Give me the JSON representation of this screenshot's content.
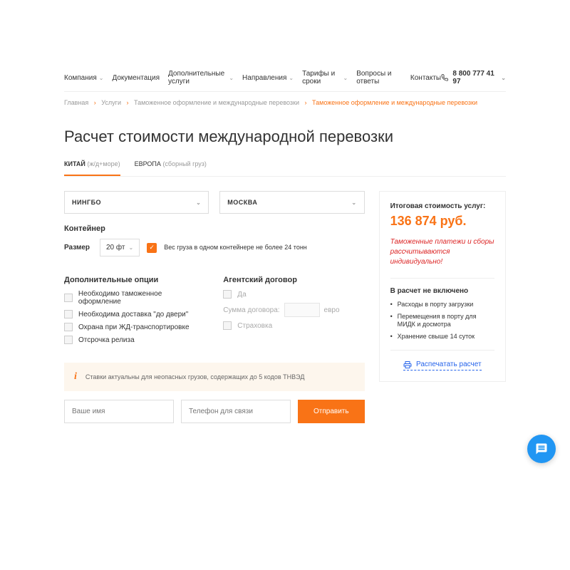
{
  "nav": {
    "items": [
      {
        "label": "Компания",
        "dropdown": true
      },
      {
        "label": "Документация",
        "dropdown": false
      },
      {
        "label": "Дополнительные услуги",
        "dropdown": true
      },
      {
        "label": "Направления",
        "dropdown": true
      },
      {
        "label": "Тарифы и сроки",
        "dropdown": true
      },
      {
        "label": "Вопросы и ответы",
        "dropdown": false
      },
      {
        "label": "Контакты",
        "dropdown": false
      }
    ],
    "phone": "8 800 777 41 97"
  },
  "breadcrumb": {
    "items": [
      "Главная",
      "Услуги",
      "Таможенное оформление и международные перевозки"
    ],
    "current": "Таможенное оформление и международные перевозки"
  },
  "page_title": "Расчет стоимости международной перевозки",
  "tabs": [
    {
      "label": "КИТАЙ",
      "sub": "(ж/д+море)"
    },
    {
      "label": "ЕВРОПА",
      "sub": "(сборный груз)"
    }
  ],
  "form": {
    "origin": "НИНГБО",
    "destination": "МОСКВА",
    "container_title": "Контейнер",
    "size_label": "Размер",
    "size_value": "20 фт",
    "weight_note": "Вес груза в одном контейнере не более 24 тонн",
    "options_title": "Дополнительные опции",
    "options": [
      "Необходимо таможенное оформление",
      "Необходима доставка \"до двери\"",
      "Охрана при ЖД-транспортировке",
      "Отсрочка релиза"
    ],
    "agent_title": "Агентский договор",
    "agent_yes": "Да",
    "amount_label": "Сумма договора:",
    "amount_currency": "евро",
    "insurance": "Страховка",
    "info_text": "Ставки актуальны для неопасных грузов, содержащих до 5 кодов ТНВЭД",
    "name_placeholder": "Ваше имя",
    "phone_placeholder": "Телефон для связи",
    "submit": "Отправить"
  },
  "summary": {
    "total_label": "Итоговая стоимость услуг:",
    "total_value": "136 874 руб.",
    "note": "Таможенные платежи и сборы рассчитываются индивидуально!",
    "excluded_title": "В расчет не включено",
    "excluded": [
      "Расходы в порту загрузки",
      "Перемещения в порту для МИДК и досмотра",
      "Хранение свыше 14 суток"
    ],
    "print_label": "Распечатать расчет"
  }
}
